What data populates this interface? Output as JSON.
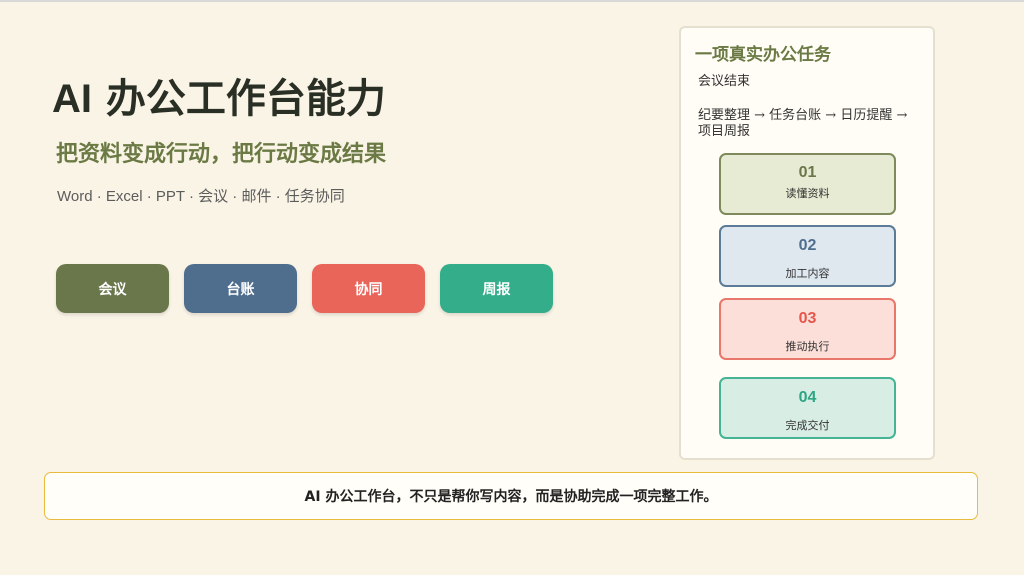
{
  "slide": {
    "title_ai": "AI",
    "title_rest": " 办公工作台能力",
    "subtitle": "把资料变成行动，把行动变成结果",
    "tagline": "Word · Excel · PPT · 会议 · 邮件 · 任务协同",
    "tags": [
      {
        "label": "会议",
        "color": "#6a774b"
      },
      {
        "label": "台账",
        "color": "#4f6e8e"
      },
      {
        "label": "协同",
        "color": "#e96459"
      },
      {
        "label": "周报",
        "color": "#33ad8a"
      }
    ]
  },
  "task_card": {
    "title": "一项真实办公任务",
    "line1": "会议结束",
    "line2": "纪要整理 → 任务台账 → 日历提醒 → 项目周报",
    "steps": [
      {
        "num": "01",
        "label": "读懂资料",
        "color": "#6a774b"
      },
      {
        "num": "02",
        "label": "加工内容",
        "color": "#4f6e8e"
      },
      {
        "num": "03",
        "label": "推动执行",
        "color": "#e5574c"
      },
      {
        "num": "04",
        "label": "完成交付",
        "color": "#2ea583"
      }
    ]
  },
  "banner": {
    "text": "AI 办公工作台，不只是帮你写内容，而是协助完成一项完整工作。"
  }
}
